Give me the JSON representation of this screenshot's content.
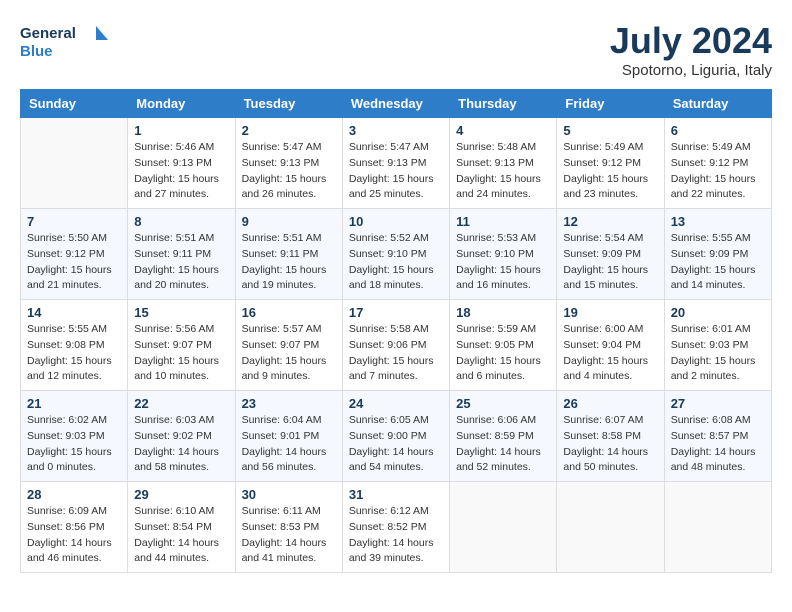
{
  "header": {
    "logo_line1": "General",
    "logo_line2": "Blue",
    "title": "July 2024",
    "subtitle": "Spotorno, Liguria, Italy"
  },
  "columns": [
    "Sunday",
    "Monday",
    "Tuesday",
    "Wednesday",
    "Thursday",
    "Friday",
    "Saturday"
  ],
  "weeks": [
    [
      {
        "day": "",
        "info": ""
      },
      {
        "day": "1",
        "info": "Sunrise: 5:46 AM\nSunset: 9:13 PM\nDaylight: 15 hours\nand 27 minutes."
      },
      {
        "day": "2",
        "info": "Sunrise: 5:47 AM\nSunset: 9:13 PM\nDaylight: 15 hours\nand 26 minutes."
      },
      {
        "day": "3",
        "info": "Sunrise: 5:47 AM\nSunset: 9:13 PM\nDaylight: 15 hours\nand 25 minutes."
      },
      {
        "day": "4",
        "info": "Sunrise: 5:48 AM\nSunset: 9:13 PM\nDaylight: 15 hours\nand 24 minutes."
      },
      {
        "day": "5",
        "info": "Sunrise: 5:49 AM\nSunset: 9:12 PM\nDaylight: 15 hours\nand 23 minutes."
      },
      {
        "day": "6",
        "info": "Sunrise: 5:49 AM\nSunset: 9:12 PM\nDaylight: 15 hours\nand 22 minutes."
      }
    ],
    [
      {
        "day": "7",
        "info": "Sunrise: 5:50 AM\nSunset: 9:12 PM\nDaylight: 15 hours\nand 21 minutes."
      },
      {
        "day": "8",
        "info": "Sunrise: 5:51 AM\nSunset: 9:11 PM\nDaylight: 15 hours\nand 20 minutes."
      },
      {
        "day": "9",
        "info": "Sunrise: 5:51 AM\nSunset: 9:11 PM\nDaylight: 15 hours\nand 19 minutes."
      },
      {
        "day": "10",
        "info": "Sunrise: 5:52 AM\nSunset: 9:10 PM\nDaylight: 15 hours\nand 18 minutes."
      },
      {
        "day": "11",
        "info": "Sunrise: 5:53 AM\nSunset: 9:10 PM\nDaylight: 15 hours\nand 16 minutes."
      },
      {
        "day": "12",
        "info": "Sunrise: 5:54 AM\nSunset: 9:09 PM\nDaylight: 15 hours\nand 15 minutes."
      },
      {
        "day": "13",
        "info": "Sunrise: 5:55 AM\nSunset: 9:09 PM\nDaylight: 15 hours\nand 14 minutes."
      }
    ],
    [
      {
        "day": "14",
        "info": "Sunrise: 5:55 AM\nSunset: 9:08 PM\nDaylight: 15 hours\nand 12 minutes."
      },
      {
        "day": "15",
        "info": "Sunrise: 5:56 AM\nSunset: 9:07 PM\nDaylight: 15 hours\nand 10 minutes."
      },
      {
        "day": "16",
        "info": "Sunrise: 5:57 AM\nSunset: 9:07 PM\nDaylight: 15 hours\nand 9 minutes."
      },
      {
        "day": "17",
        "info": "Sunrise: 5:58 AM\nSunset: 9:06 PM\nDaylight: 15 hours\nand 7 minutes."
      },
      {
        "day": "18",
        "info": "Sunrise: 5:59 AM\nSunset: 9:05 PM\nDaylight: 15 hours\nand 6 minutes."
      },
      {
        "day": "19",
        "info": "Sunrise: 6:00 AM\nSunset: 9:04 PM\nDaylight: 15 hours\nand 4 minutes."
      },
      {
        "day": "20",
        "info": "Sunrise: 6:01 AM\nSunset: 9:03 PM\nDaylight: 15 hours\nand 2 minutes."
      }
    ],
    [
      {
        "day": "21",
        "info": "Sunrise: 6:02 AM\nSunset: 9:03 PM\nDaylight: 15 hours\nand 0 minutes."
      },
      {
        "day": "22",
        "info": "Sunrise: 6:03 AM\nSunset: 9:02 PM\nDaylight: 14 hours\nand 58 minutes."
      },
      {
        "day": "23",
        "info": "Sunrise: 6:04 AM\nSunset: 9:01 PM\nDaylight: 14 hours\nand 56 minutes."
      },
      {
        "day": "24",
        "info": "Sunrise: 6:05 AM\nSunset: 9:00 PM\nDaylight: 14 hours\nand 54 minutes."
      },
      {
        "day": "25",
        "info": "Sunrise: 6:06 AM\nSunset: 8:59 PM\nDaylight: 14 hours\nand 52 minutes."
      },
      {
        "day": "26",
        "info": "Sunrise: 6:07 AM\nSunset: 8:58 PM\nDaylight: 14 hours\nand 50 minutes."
      },
      {
        "day": "27",
        "info": "Sunrise: 6:08 AM\nSunset: 8:57 PM\nDaylight: 14 hours\nand 48 minutes."
      }
    ],
    [
      {
        "day": "28",
        "info": "Sunrise: 6:09 AM\nSunset: 8:56 PM\nDaylight: 14 hours\nand 46 minutes."
      },
      {
        "day": "29",
        "info": "Sunrise: 6:10 AM\nSunset: 8:54 PM\nDaylight: 14 hours\nand 44 minutes."
      },
      {
        "day": "30",
        "info": "Sunrise: 6:11 AM\nSunset: 8:53 PM\nDaylight: 14 hours\nand 41 minutes."
      },
      {
        "day": "31",
        "info": "Sunrise: 6:12 AM\nSunset: 8:52 PM\nDaylight: 14 hours\nand 39 minutes."
      },
      {
        "day": "",
        "info": ""
      },
      {
        "day": "",
        "info": ""
      },
      {
        "day": "",
        "info": ""
      }
    ]
  ]
}
